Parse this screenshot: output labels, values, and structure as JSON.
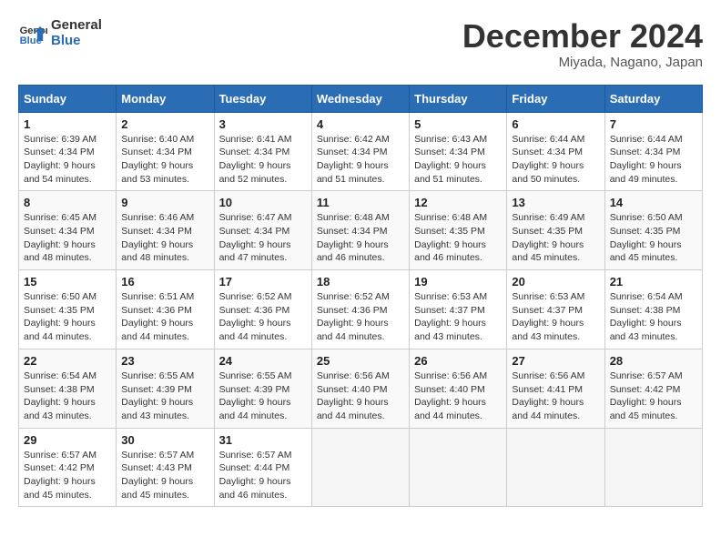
{
  "header": {
    "logo_line1": "General",
    "logo_line2": "Blue",
    "month_title": "December 2024",
    "subtitle": "Miyada, Nagano, Japan"
  },
  "days_of_week": [
    "Sunday",
    "Monday",
    "Tuesday",
    "Wednesday",
    "Thursday",
    "Friday",
    "Saturday"
  ],
  "weeks": [
    [
      {
        "day": "1",
        "sunrise": "6:39 AM",
        "sunset": "4:34 PM",
        "daylight": "9 hours and 54 minutes."
      },
      {
        "day": "2",
        "sunrise": "6:40 AM",
        "sunset": "4:34 PM",
        "daylight": "9 hours and 53 minutes."
      },
      {
        "day": "3",
        "sunrise": "6:41 AM",
        "sunset": "4:34 PM",
        "daylight": "9 hours and 52 minutes."
      },
      {
        "day": "4",
        "sunrise": "6:42 AM",
        "sunset": "4:34 PM",
        "daylight": "9 hours and 51 minutes."
      },
      {
        "day": "5",
        "sunrise": "6:43 AM",
        "sunset": "4:34 PM",
        "daylight": "9 hours and 51 minutes."
      },
      {
        "day": "6",
        "sunrise": "6:44 AM",
        "sunset": "4:34 PM",
        "daylight": "9 hours and 50 minutes."
      },
      {
        "day": "7",
        "sunrise": "6:44 AM",
        "sunset": "4:34 PM",
        "daylight": "9 hours and 49 minutes."
      }
    ],
    [
      {
        "day": "8",
        "sunrise": "6:45 AM",
        "sunset": "4:34 PM",
        "daylight": "9 hours and 48 minutes."
      },
      {
        "day": "9",
        "sunrise": "6:46 AM",
        "sunset": "4:34 PM",
        "daylight": "9 hours and 48 minutes."
      },
      {
        "day": "10",
        "sunrise": "6:47 AM",
        "sunset": "4:34 PM",
        "daylight": "9 hours and 47 minutes."
      },
      {
        "day": "11",
        "sunrise": "6:48 AM",
        "sunset": "4:34 PM",
        "daylight": "9 hours and 46 minutes."
      },
      {
        "day": "12",
        "sunrise": "6:48 AM",
        "sunset": "4:35 PM",
        "daylight": "9 hours and 46 minutes."
      },
      {
        "day": "13",
        "sunrise": "6:49 AM",
        "sunset": "4:35 PM",
        "daylight": "9 hours and 45 minutes."
      },
      {
        "day": "14",
        "sunrise": "6:50 AM",
        "sunset": "4:35 PM",
        "daylight": "9 hours and 45 minutes."
      }
    ],
    [
      {
        "day": "15",
        "sunrise": "6:50 AM",
        "sunset": "4:35 PM",
        "daylight": "9 hours and 44 minutes."
      },
      {
        "day": "16",
        "sunrise": "6:51 AM",
        "sunset": "4:36 PM",
        "daylight": "9 hours and 44 minutes."
      },
      {
        "day": "17",
        "sunrise": "6:52 AM",
        "sunset": "4:36 PM",
        "daylight": "9 hours and 44 minutes."
      },
      {
        "day": "18",
        "sunrise": "6:52 AM",
        "sunset": "4:36 PM",
        "daylight": "9 hours and 44 minutes."
      },
      {
        "day": "19",
        "sunrise": "6:53 AM",
        "sunset": "4:37 PM",
        "daylight": "9 hours and 43 minutes."
      },
      {
        "day": "20",
        "sunrise": "6:53 AM",
        "sunset": "4:37 PM",
        "daylight": "9 hours and 43 minutes."
      },
      {
        "day": "21",
        "sunrise": "6:54 AM",
        "sunset": "4:38 PM",
        "daylight": "9 hours and 43 minutes."
      }
    ],
    [
      {
        "day": "22",
        "sunrise": "6:54 AM",
        "sunset": "4:38 PM",
        "daylight": "9 hours and 43 minutes."
      },
      {
        "day": "23",
        "sunrise": "6:55 AM",
        "sunset": "4:39 PM",
        "daylight": "9 hours and 43 minutes."
      },
      {
        "day": "24",
        "sunrise": "6:55 AM",
        "sunset": "4:39 PM",
        "daylight": "9 hours and 44 minutes."
      },
      {
        "day": "25",
        "sunrise": "6:56 AM",
        "sunset": "4:40 PM",
        "daylight": "9 hours and 44 minutes."
      },
      {
        "day": "26",
        "sunrise": "6:56 AM",
        "sunset": "4:40 PM",
        "daylight": "9 hours and 44 minutes."
      },
      {
        "day": "27",
        "sunrise": "6:56 AM",
        "sunset": "4:41 PM",
        "daylight": "9 hours and 44 minutes."
      },
      {
        "day": "28",
        "sunrise": "6:57 AM",
        "sunset": "4:42 PM",
        "daylight": "9 hours and 45 minutes."
      }
    ],
    [
      {
        "day": "29",
        "sunrise": "6:57 AM",
        "sunset": "4:42 PM",
        "daylight": "9 hours and 45 minutes."
      },
      {
        "day": "30",
        "sunrise": "6:57 AM",
        "sunset": "4:43 PM",
        "daylight": "9 hours and 45 minutes."
      },
      {
        "day": "31",
        "sunrise": "6:57 AM",
        "sunset": "4:44 PM",
        "daylight": "9 hours and 46 minutes."
      },
      null,
      null,
      null,
      null
    ]
  ],
  "labels": {
    "sunrise": "Sunrise:",
    "sunset": "Sunset:",
    "daylight": "Daylight:"
  }
}
